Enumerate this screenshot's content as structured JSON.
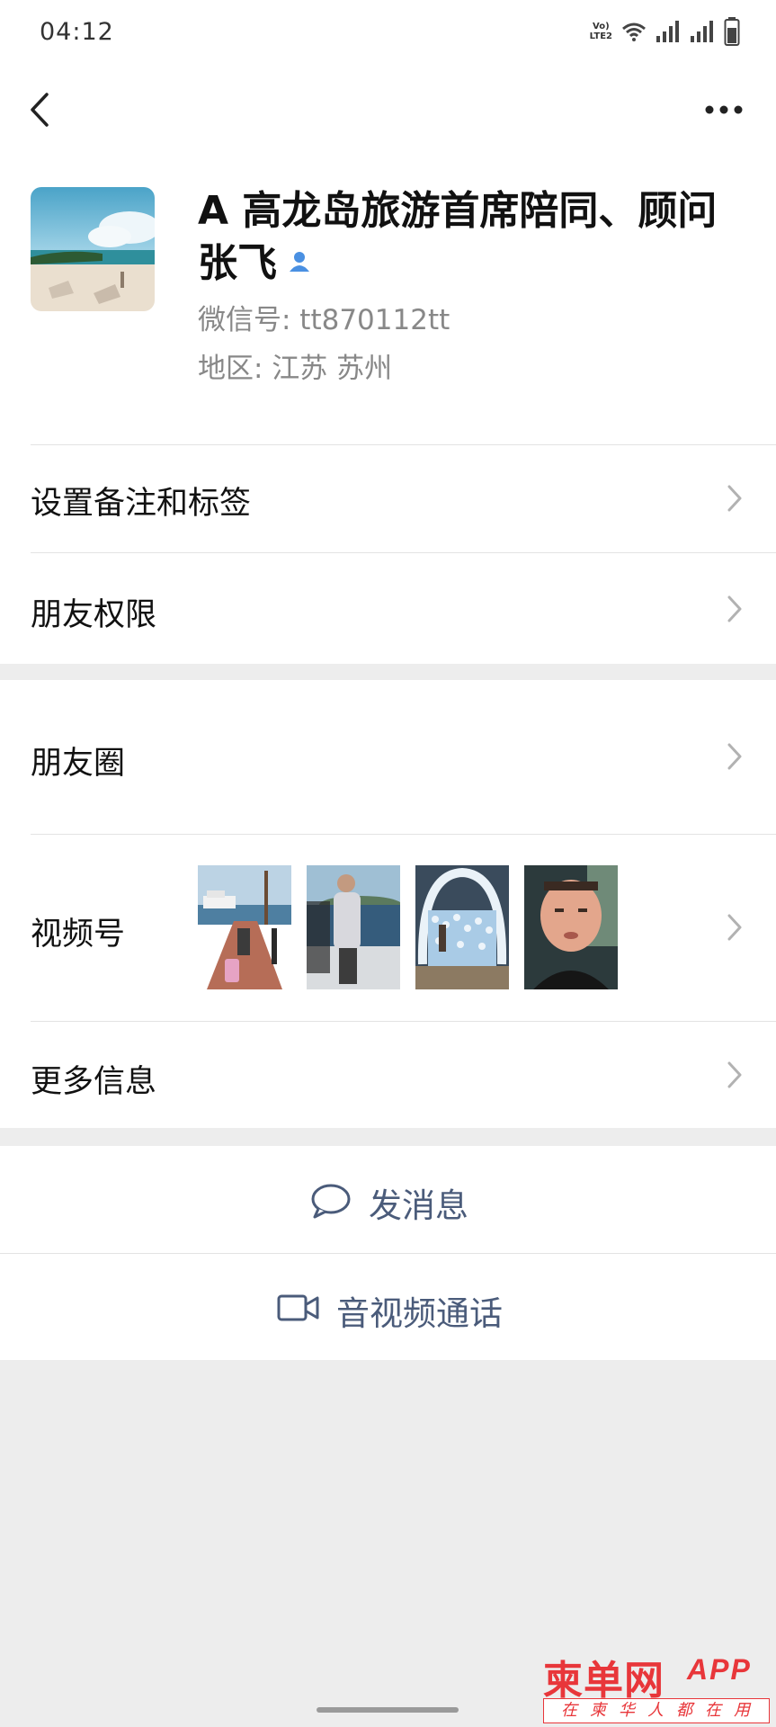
{
  "status_bar": {
    "time": "04:12",
    "network_label_top": "Vo)",
    "network_label_bottom": "LTE2",
    "icons": [
      "volte-icon",
      "wifi-icon",
      "signal-icon",
      "signal-icon-2",
      "battery-icon"
    ]
  },
  "nav": {
    "back_icon": "chevron-left-icon",
    "more_icon": "more-dots-icon"
  },
  "profile": {
    "name": "A 高龙岛旅游首席陪同、顾问张飞",
    "verified_icon": "person-badge-icon",
    "wechat_id": "微信号: tt870112tt",
    "region": "地区: 江苏 苏州"
  },
  "menu": {
    "remark_tags": "设置备注和标签",
    "friend_permissions": "朋友权限",
    "moments": "朋友圈",
    "channels": "视频号",
    "more_info": "更多信息"
  },
  "channels_thumbnails": [
    "boat-pier-photo",
    "yacht-deck-photo",
    "balloon-boat-photo",
    "man-portrait-photo"
  ],
  "actions": {
    "send_message": "发消息",
    "video_call": "音视频通话"
  },
  "watermark": {
    "logo": "柬单网",
    "app": "APP",
    "slogan": "在柬华人都在用"
  },
  "colors": {
    "background": "#ededed",
    "action_text": "#4a5b7a",
    "verified": "#4a90e2",
    "watermark": "#e8363a"
  }
}
